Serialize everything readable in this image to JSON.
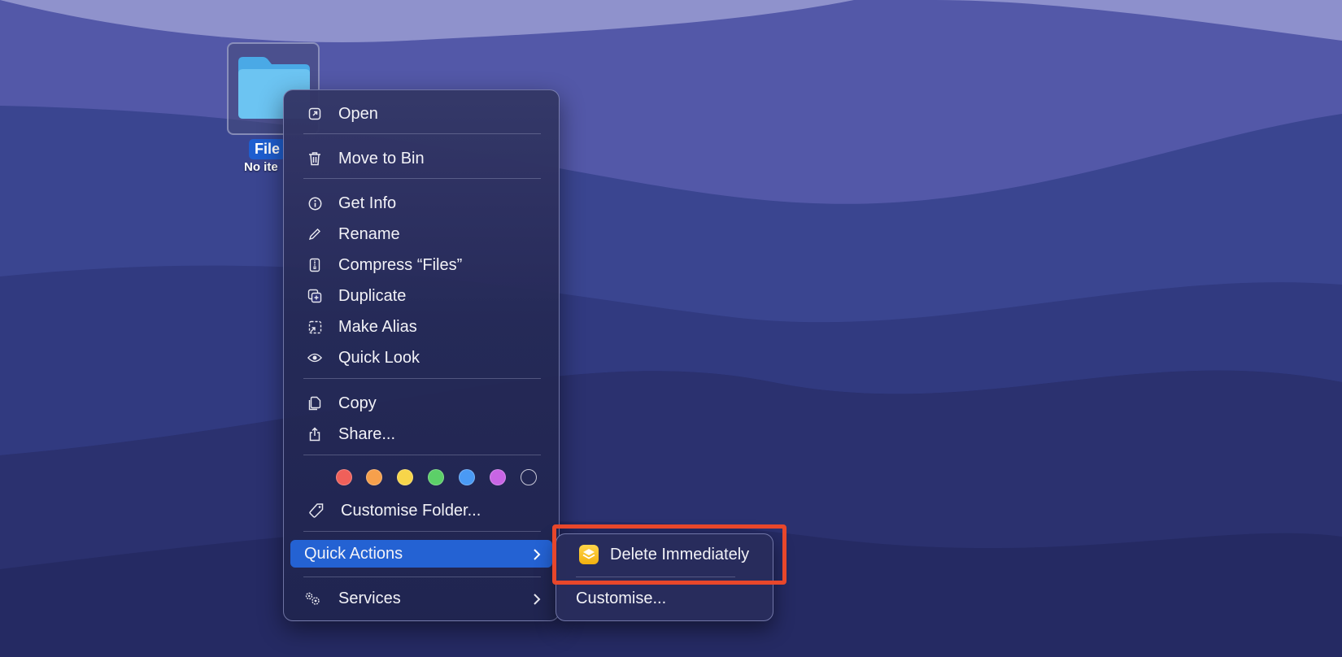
{
  "desktop": {
    "folder_label": "File",
    "folder_sublabel": "No ite"
  },
  "context_menu": {
    "open": "Open",
    "move_to_bin": "Move to Bin",
    "get_info": "Get Info",
    "rename": "Rename",
    "compress": "Compress “Files”",
    "duplicate": "Duplicate",
    "make_alias": "Make Alias",
    "quick_look": "Quick Look",
    "copy": "Copy",
    "share": "Share...",
    "tag_colors": [
      "#f0605a",
      "#f6a04c",
      "#f7d54a",
      "#5cd068",
      "#4a9af5",
      "#c865e5"
    ],
    "customise_folder": "Customise Folder...",
    "quick_actions": "Quick Actions",
    "services": "Services"
  },
  "submenu": {
    "delete_immediately": "Delete Immediately",
    "customise": "Customise..."
  },
  "colors": {
    "highlight": "#2462d3",
    "annotation": "#e8472b"
  }
}
